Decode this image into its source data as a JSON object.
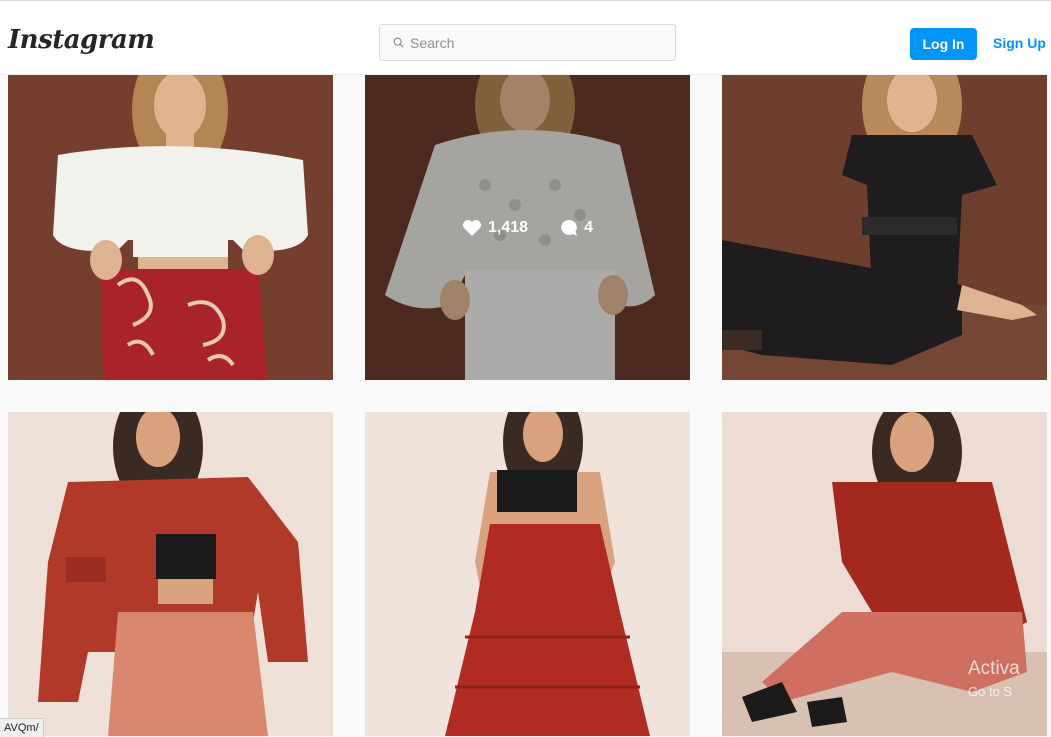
{
  "header": {
    "logo": "Instagram",
    "search_placeholder": "Search",
    "login_label": "Log In",
    "signup_label": "Sign Up"
  },
  "posts": [
    {
      "alt": "White off-shoulder crop top with red floral pants"
    },
    {
      "alt": "White eyelet blouse with white denim shorts",
      "likes": "1,418",
      "comments": "4"
    },
    {
      "alt": "Black belted jumpsuit seated pose"
    },
    {
      "alt": "Rust overshirt with black bandeau and blush pants"
    },
    {
      "alt": "Black bandeau top with red tiered maxi skirt"
    },
    {
      "alt": "Red sheer blouse with pink wide-leg pants seated"
    }
  ],
  "status_bar": {
    "url_fragment": "AVQm/"
  },
  "watermark": {
    "line1": "Activa",
    "line2": "Go to S"
  },
  "colors": {
    "accent": "#0095f6",
    "background": "#fafafa"
  }
}
